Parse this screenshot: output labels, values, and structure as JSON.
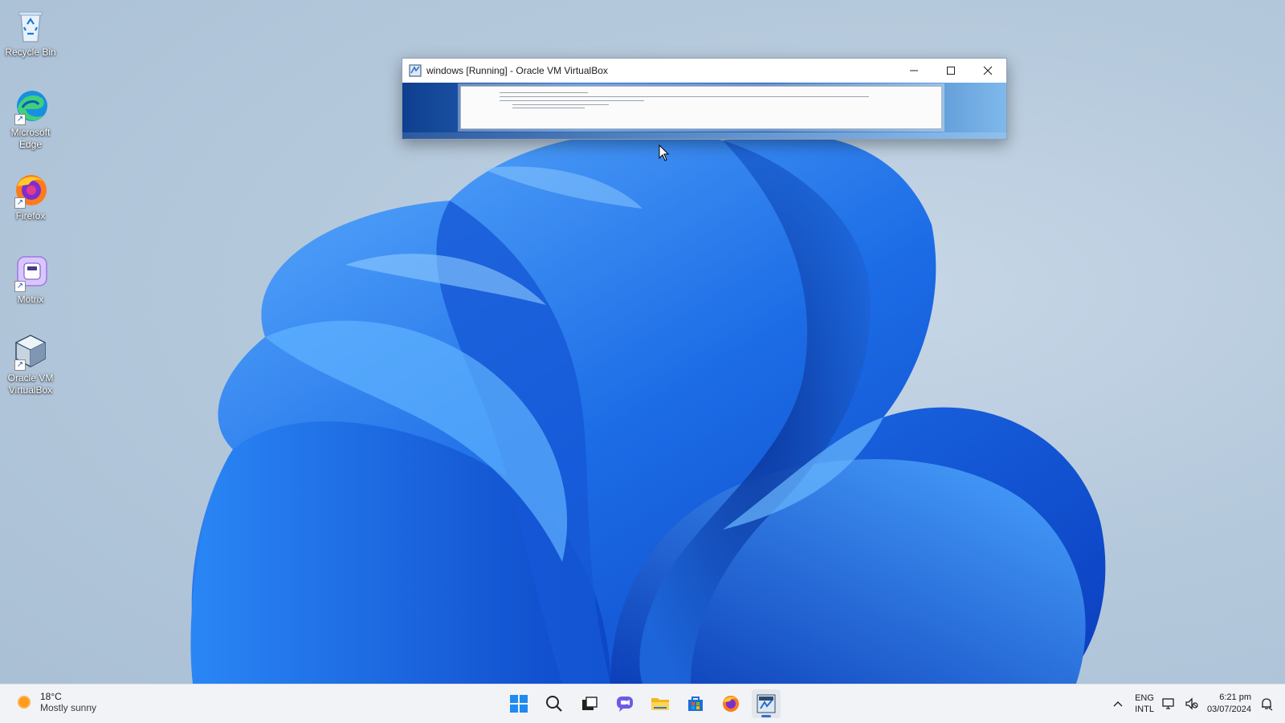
{
  "desktop": {
    "icons": [
      {
        "label": "Recycle Bin",
        "icon": "recycle-bin-icon"
      },
      {
        "label": "Microsoft Edge",
        "icon": "edge-icon"
      },
      {
        "label": "Firefox",
        "icon": "firefox-icon"
      },
      {
        "label": "Motrix",
        "icon": "motrix-icon"
      },
      {
        "label": "Oracle VM VirtualBox",
        "icon": "virtualbox-icon"
      }
    ]
  },
  "vbox_window": {
    "title": "windows  [Running] - Oracle VM VirtualBox",
    "controls": [
      "minimize-icon",
      "maximize-icon",
      "close-icon"
    ]
  },
  "taskbar": {
    "weather": {
      "temp": "18°C",
      "condition": "Mostly sunny",
      "icon": "sun-icon"
    },
    "apps": [
      "start-icon",
      "search-icon",
      "task-view-icon",
      "chat-icon",
      "file-explorer-icon",
      "store-icon",
      "firefox-icon",
      "virtualbox-icon"
    ],
    "active_app": "virtualbox-icon",
    "tray": {
      "lang_line1": "ENG",
      "lang_line2": "INTL",
      "time": "6:21 pm",
      "date": "03/07/2024"
    }
  },
  "colors": {
    "wallpaper_bg": "#b5c9dc",
    "bloom_blue": "#1f6fe0",
    "taskbar_bg": "#f1f3f6",
    "accent": "#2f6fd6"
  }
}
